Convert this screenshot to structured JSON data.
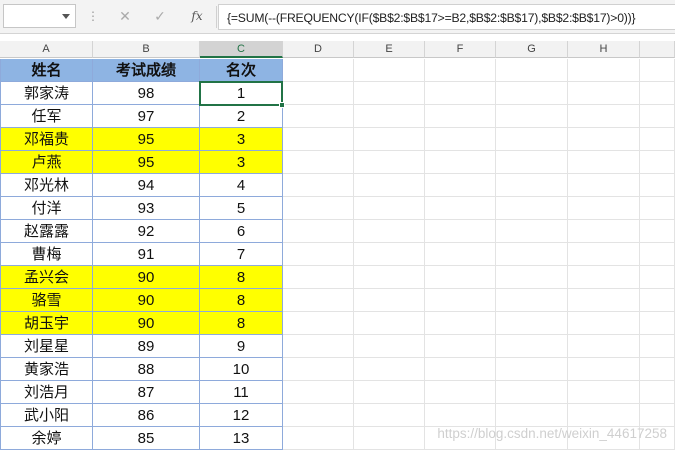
{
  "formula_bar": {
    "name_box": "",
    "separator": "⋮",
    "cancel_icon": "✕",
    "enter_icon": "✓",
    "fx_label": "fx",
    "formula": "{=SUM(--(FREQUENCY(IF($B$2:$B$17>=B2,$B$2:$B$17),$B$2:$B$17)>0))}"
  },
  "columns": [
    "A",
    "B",
    "C",
    "D",
    "E",
    "F",
    "G",
    "H"
  ],
  "selected_column": "C",
  "table": {
    "headers": [
      "姓名",
      "考试成绩",
      "名次"
    ],
    "rows": [
      {
        "name": "郭家涛",
        "score": "98",
        "rank": "1",
        "highlight": false
      },
      {
        "name": "任军",
        "score": "97",
        "rank": "2",
        "highlight": false
      },
      {
        "name": "邓福贵",
        "score": "95",
        "rank": "3",
        "highlight": true
      },
      {
        "name": "卢燕",
        "score": "95",
        "rank": "3",
        "highlight": true
      },
      {
        "name": "邓光林",
        "score": "94",
        "rank": "4",
        "highlight": false
      },
      {
        "name": "付洋",
        "score": "93",
        "rank": "5",
        "highlight": false
      },
      {
        "name": "赵露露",
        "score": "92",
        "rank": "6",
        "highlight": false
      },
      {
        "name": "曹梅",
        "score": "91",
        "rank": "7",
        "highlight": false
      },
      {
        "name": "孟兴会",
        "score": "90",
        "rank": "8",
        "highlight": true
      },
      {
        "name": "骆雪",
        "score": "90",
        "rank": "8",
        "highlight": true
      },
      {
        "name": "胡玉宇",
        "score": "90",
        "rank": "8",
        "highlight": true
      },
      {
        "name": "刘星星",
        "score": "89",
        "rank": "9",
        "highlight": false
      },
      {
        "name": "黄家浩",
        "score": "88",
        "rank": "10",
        "highlight": false
      },
      {
        "name": "刘浩月",
        "score": "87",
        "rank": "11",
        "highlight": false
      },
      {
        "name": "武小阳",
        "score": "86",
        "rank": "12",
        "highlight": false
      },
      {
        "name": "余婷",
        "score": "85",
        "rank": "13",
        "highlight": false
      }
    ]
  },
  "colors": {
    "header_fill": "#8eb4e3",
    "highlight_fill": "#ffff00",
    "selection": "#217346"
  },
  "watermark": "https://blog.csdn.net/weixin_44617258"
}
